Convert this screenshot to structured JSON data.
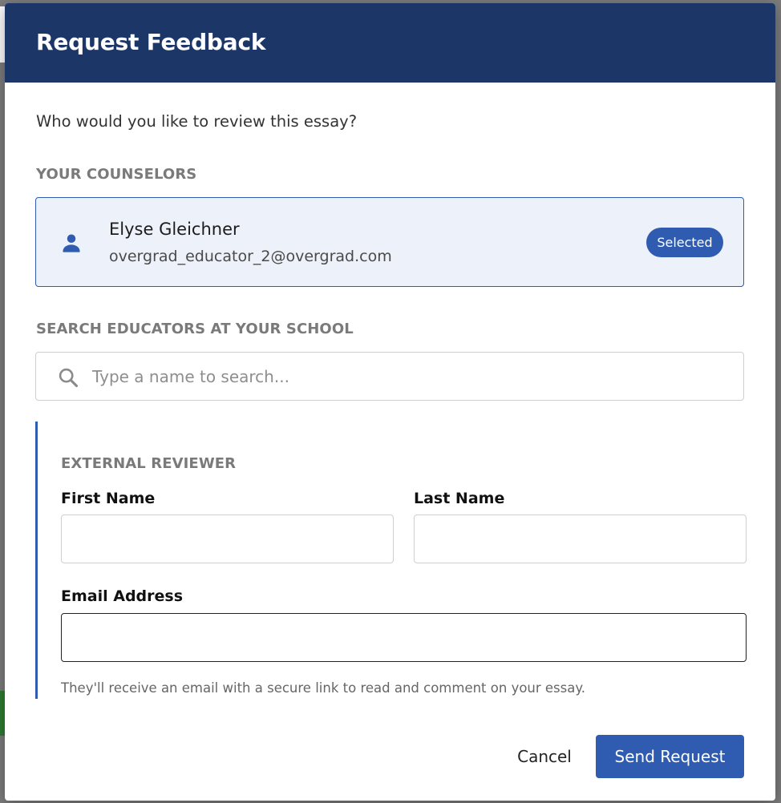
{
  "modal": {
    "title": "Request Feedback",
    "prompt": "Who would you like to review this essay?"
  },
  "counselors": {
    "section_label": "YOUR COUNSELORS",
    "items": [
      {
        "name": "Elyse Gleichner",
        "email": "overgrad_educator_2@overgrad.com",
        "badge": "Selected",
        "icon": "person-icon"
      }
    ]
  },
  "search": {
    "section_label": "SEARCH EDUCATORS AT YOUR SCHOOL",
    "placeholder": "Type a name to search...",
    "value": "",
    "icon": "search-icon"
  },
  "external": {
    "section_label": "EXTERNAL REVIEWER",
    "first_name_label": "First Name",
    "first_name_value": "",
    "last_name_label": "Last Name",
    "last_name_value": "",
    "email_label": "Email Address",
    "email_value": "",
    "helper": "They'll receive an email with a secure link to read and comment on your essay."
  },
  "actions": {
    "cancel_label": "Cancel",
    "send_label": "Send Request"
  },
  "colors": {
    "header_bg": "#1c3767",
    "accent": "#2f5cb0",
    "selected_card_bg": "#edf1f9"
  }
}
